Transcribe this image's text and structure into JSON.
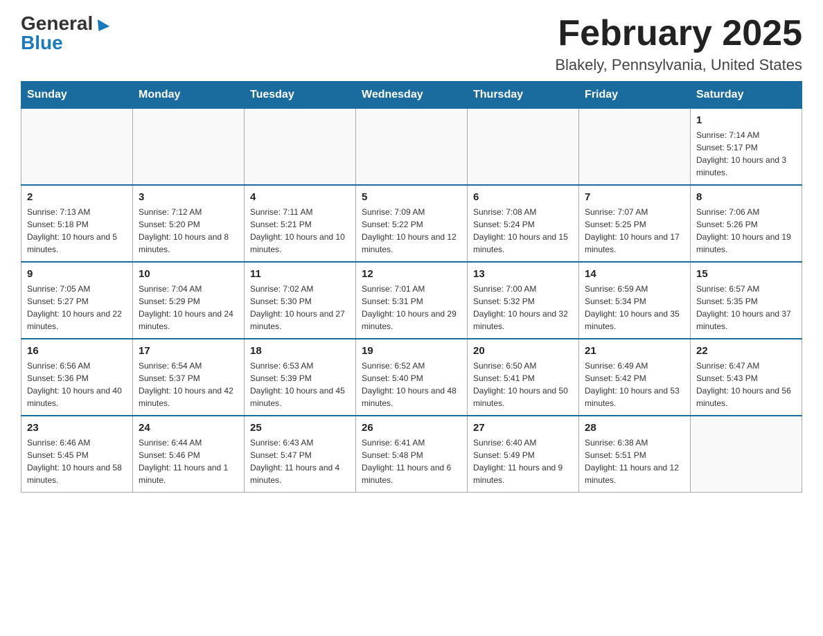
{
  "header": {
    "logo_general": "General",
    "logo_blue": "Blue",
    "month_title": "February 2025",
    "location": "Blakely, Pennsylvania, United States"
  },
  "days_of_week": [
    "Sunday",
    "Monday",
    "Tuesday",
    "Wednesday",
    "Thursday",
    "Friday",
    "Saturday"
  ],
  "weeks": [
    [
      {
        "day": "",
        "info": ""
      },
      {
        "day": "",
        "info": ""
      },
      {
        "day": "",
        "info": ""
      },
      {
        "day": "",
        "info": ""
      },
      {
        "day": "",
        "info": ""
      },
      {
        "day": "",
        "info": ""
      },
      {
        "day": "1",
        "info": "Sunrise: 7:14 AM\nSunset: 5:17 PM\nDaylight: 10 hours and 3 minutes."
      }
    ],
    [
      {
        "day": "2",
        "info": "Sunrise: 7:13 AM\nSunset: 5:18 PM\nDaylight: 10 hours and 5 minutes."
      },
      {
        "day": "3",
        "info": "Sunrise: 7:12 AM\nSunset: 5:20 PM\nDaylight: 10 hours and 8 minutes."
      },
      {
        "day": "4",
        "info": "Sunrise: 7:11 AM\nSunset: 5:21 PM\nDaylight: 10 hours and 10 minutes."
      },
      {
        "day": "5",
        "info": "Sunrise: 7:09 AM\nSunset: 5:22 PM\nDaylight: 10 hours and 12 minutes."
      },
      {
        "day": "6",
        "info": "Sunrise: 7:08 AM\nSunset: 5:24 PM\nDaylight: 10 hours and 15 minutes."
      },
      {
        "day": "7",
        "info": "Sunrise: 7:07 AM\nSunset: 5:25 PM\nDaylight: 10 hours and 17 minutes."
      },
      {
        "day": "8",
        "info": "Sunrise: 7:06 AM\nSunset: 5:26 PM\nDaylight: 10 hours and 19 minutes."
      }
    ],
    [
      {
        "day": "9",
        "info": "Sunrise: 7:05 AM\nSunset: 5:27 PM\nDaylight: 10 hours and 22 minutes."
      },
      {
        "day": "10",
        "info": "Sunrise: 7:04 AM\nSunset: 5:29 PM\nDaylight: 10 hours and 24 minutes."
      },
      {
        "day": "11",
        "info": "Sunrise: 7:02 AM\nSunset: 5:30 PM\nDaylight: 10 hours and 27 minutes."
      },
      {
        "day": "12",
        "info": "Sunrise: 7:01 AM\nSunset: 5:31 PM\nDaylight: 10 hours and 29 minutes."
      },
      {
        "day": "13",
        "info": "Sunrise: 7:00 AM\nSunset: 5:32 PM\nDaylight: 10 hours and 32 minutes."
      },
      {
        "day": "14",
        "info": "Sunrise: 6:59 AM\nSunset: 5:34 PM\nDaylight: 10 hours and 35 minutes."
      },
      {
        "day": "15",
        "info": "Sunrise: 6:57 AM\nSunset: 5:35 PM\nDaylight: 10 hours and 37 minutes."
      }
    ],
    [
      {
        "day": "16",
        "info": "Sunrise: 6:56 AM\nSunset: 5:36 PM\nDaylight: 10 hours and 40 minutes."
      },
      {
        "day": "17",
        "info": "Sunrise: 6:54 AM\nSunset: 5:37 PM\nDaylight: 10 hours and 42 minutes."
      },
      {
        "day": "18",
        "info": "Sunrise: 6:53 AM\nSunset: 5:39 PM\nDaylight: 10 hours and 45 minutes."
      },
      {
        "day": "19",
        "info": "Sunrise: 6:52 AM\nSunset: 5:40 PM\nDaylight: 10 hours and 48 minutes."
      },
      {
        "day": "20",
        "info": "Sunrise: 6:50 AM\nSunset: 5:41 PM\nDaylight: 10 hours and 50 minutes."
      },
      {
        "day": "21",
        "info": "Sunrise: 6:49 AM\nSunset: 5:42 PM\nDaylight: 10 hours and 53 minutes."
      },
      {
        "day": "22",
        "info": "Sunrise: 6:47 AM\nSunset: 5:43 PM\nDaylight: 10 hours and 56 minutes."
      }
    ],
    [
      {
        "day": "23",
        "info": "Sunrise: 6:46 AM\nSunset: 5:45 PM\nDaylight: 10 hours and 58 minutes."
      },
      {
        "day": "24",
        "info": "Sunrise: 6:44 AM\nSunset: 5:46 PM\nDaylight: 11 hours and 1 minute."
      },
      {
        "day": "25",
        "info": "Sunrise: 6:43 AM\nSunset: 5:47 PM\nDaylight: 11 hours and 4 minutes."
      },
      {
        "day": "26",
        "info": "Sunrise: 6:41 AM\nSunset: 5:48 PM\nDaylight: 11 hours and 6 minutes."
      },
      {
        "day": "27",
        "info": "Sunrise: 6:40 AM\nSunset: 5:49 PM\nDaylight: 11 hours and 9 minutes."
      },
      {
        "day": "28",
        "info": "Sunrise: 6:38 AM\nSunset: 5:51 PM\nDaylight: 11 hours and 12 minutes."
      },
      {
        "day": "",
        "info": ""
      }
    ]
  ]
}
